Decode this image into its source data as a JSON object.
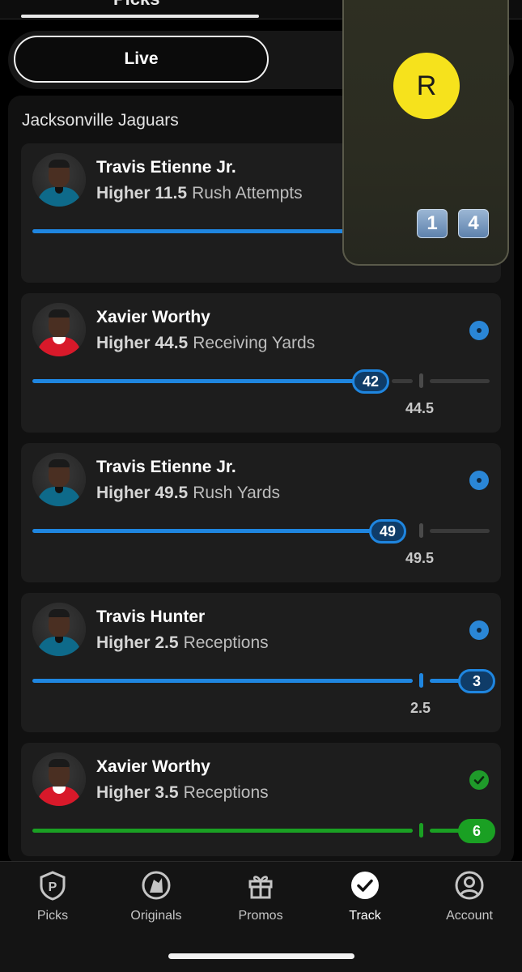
{
  "header": {
    "top_tab": "Picks",
    "live_tab": "Live"
  },
  "team": "Jacksonville Jaguars",
  "overlay": {
    "letter": "R",
    "keys": [
      "1",
      "4"
    ],
    "colors": {
      "circle": "#f6e21c"
    }
  },
  "picks": [
    {
      "player": "Travis Etienne Jr.",
      "direction": "Higher",
      "line": "11.5",
      "stat": "Rush Attempts",
      "status": "live",
      "jersey": "jaguars"
    },
    {
      "player": "Xavier Worthy",
      "direction": "Higher",
      "line": "44.5",
      "stat": "Receiving Yards",
      "current": "42",
      "line_label": "44.5",
      "status": "live",
      "jersey": "chiefs"
    },
    {
      "player": "Travis Etienne Jr.",
      "direction": "Higher",
      "line": "49.5",
      "stat": "Rush Yards",
      "current": "49",
      "line_label": "49.5",
      "status": "live",
      "jersey": "jaguars"
    },
    {
      "player": "Travis Hunter",
      "direction": "Higher",
      "line": "2.5",
      "stat": "Receptions",
      "current": "3",
      "line_label": "2.5",
      "status": "live",
      "jersey": "jaguars"
    },
    {
      "player": "Xavier Worthy",
      "direction": "Higher",
      "line": "3.5",
      "stat": "Receptions",
      "current": "6",
      "status": "hit",
      "jersey": "chiefs"
    }
  ],
  "nav": {
    "items": [
      {
        "label": "Picks",
        "icon": "picks-icon"
      },
      {
        "label": "Originals",
        "icon": "originals-icon"
      },
      {
        "label": "Promos",
        "icon": "gift-icon"
      },
      {
        "label": "Track",
        "icon": "check-circle-icon"
      },
      {
        "label": "Account",
        "icon": "user-circle-icon"
      }
    ],
    "active": "Track"
  },
  "colors": {
    "live_blue": "#1f86e0",
    "win_green": "#1aa023",
    "card": "#1d1d1d"
  }
}
